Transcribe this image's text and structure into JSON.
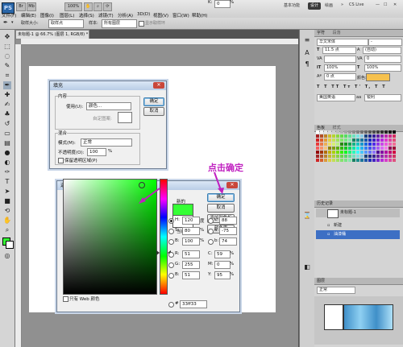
{
  "app": {
    "logo": "PS"
  },
  "menubar": {
    "items": [
      "文件(F)",
      "编辑(E)",
      "图像(I)",
      "图层(L)",
      "选择(S)",
      "滤镜(T)",
      "分析(A)",
      "3D(D)",
      "视图(V)",
      "窗口(W)",
      "帮助(H)"
    ],
    "zoom": "100%",
    "workspaces": [
      "基本功能",
      "设计",
      "绘画"
    ],
    "active_workspace": "设计",
    "extra": "CS Live"
  },
  "options_bar": {
    "sample_size_label": "取样大小:",
    "sample_size_value": "取样点",
    "sample_label": "样本:",
    "sample_value": "所有图层",
    "show_ring": "显示取样环"
  },
  "document": {
    "tab_title": "未标题-1 @ 66.7% (图层 1, RGB/8) *"
  },
  "annotation": "点击确定",
  "fill_dialog": {
    "title": "填充",
    "content_group": "内容",
    "use_label": "使用(U):",
    "use_value": "颜色...",
    "custom_pattern": "自定图案:",
    "blend_group": "混合",
    "mode_label": "模式(M):",
    "mode_value": "正常",
    "opacity_label": "不透明度(O):",
    "opacity_value": "100",
    "opacity_unit": "%",
    "preserve_transparency": "保留透明区域(P)",
    "ok": "确定",
    "cancel": "取消"
  },
  "color_dialog": {
    "title": "选取一种颜色:",
    "new_label": "新的",
    "current_label": "当前",
    "ok": "确定",
    "cancel": "取消",
    "add_swatch": "添加到色板",
    "color_libraries": "颜色库",
    "only_web": "只有 Web 颜色",
    "hex_prefix": "#",
    "hex": "33ff33",
    "fields": [
      {
        "label": "H:",
        "value": "120",
        "unit": "度"
      },
      {
        "label": "S:",
        "value": "80",
        "unit": "%"
      },
      {
        "label": "B:",
        "value": "100",
        "unit": "%"
      },
      {
        "label": "R:",
        "value": "51",
        "unit": ""
      },
      {
        "label": "G:",
        "value": "255",
        "unit": ""
      },
      {
        "label": "B:",
        "value": "51",
        "unit": ""
      }
    ],
    "lab_fields": [
      {
        "label": "L:",
        "value": "88"
      },
      {
        "label": "a:",
        "value": "-75"
      },
      {
        "label": "b:",
        "value": "74"
      }
    ],
    "cmyk_fields": [
      {
        "label": "C:",
        "value": "59",
        "unit": "%"
      },
      {
        "label": "M:",
        "value": "0",
        "unit": "%"
      },
      {
        "label": "Y:",
        "value": "95",
        "unit": "%"
      },
      {
        "label": "K:",
        "value": "0",
        "unit": "%"
      }
    ],
    "new_color": "#35ff35",
    "current_color": "#ffffff"
  },
  "right_panels": {
    "char_tab": "字符",
    "para_tab": "段落",
    "font_family": "华文宋体",
    "font_size": "11.5 点",
    "auto_leading": "(自动)",
    "tracking": "0",
    "scale_v": "100%",
    "scale_h": "100%",
    "baseline": "0 点",
    "color_label": "颜色:",
    "language": "美国英语",
    "aa": "锐利",
    "swatches_tab": "色板",
    "styles_tab": "样式",
    "history_tab": "历史记录",
    "history_doc": "未标题-1",
    "history_items": [
      "新建",
      "油漆桶"
    ],
    "layers_tab": "图层",
    "layers_mode": "正常"
  }
}
